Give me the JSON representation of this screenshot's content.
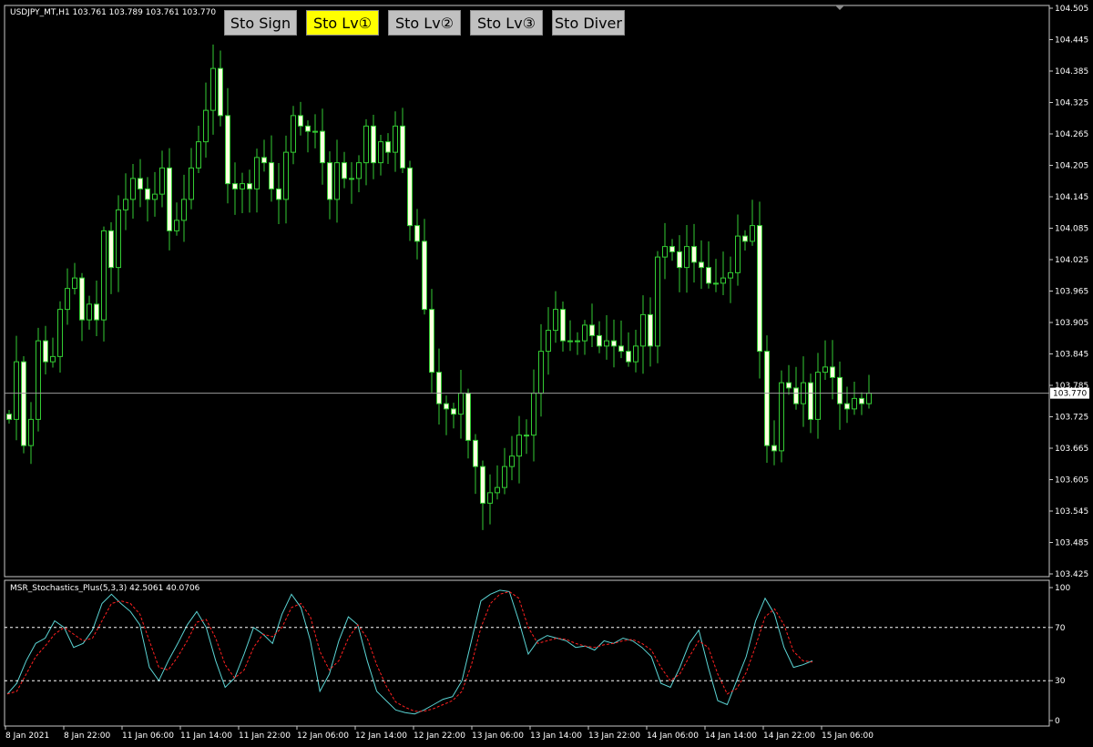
{
  "header": {
    "symbol_info": "USDJPY_MT,H1  103.761 103.789 103.761 103.770"
  },
  "indicator_header": {
    "text": "MSR_Stochastics_Plus(5,3,3) 42.5061 40.0706"
  },
  "buttons": [
    {
      "label": "Sto Sign",
      "color": "#c0c0c0"
    },
    {
      "label": "Sto Lv①",
      "color": "#ffff00"
    },
    {
      "label": "Sto Lv②",
      "color": "#c0c0c0"
    },
    {
      "label": "Sto Lv③",
      "color": "#c0c0c0"
    },
    {
      "label": "Sto Diver",
      "color": "#c0c0c0"
    }
  ],
  "colors": {
    "background": "#000000",
    "frame": "#c8c8c8",
    "candle": "#33cc33",
    "candle_bull_body": "#000000",
    "candle_bear_body": "#ffffe0",
    "stoch_main": "#5bd5d5",
    "stoch_signal": "#ff2020",
    "level_line": "#ffffff",
    "price_line": "#9a9a9a"
  },
  "chart_data": [
    {
      "type": "candlestick",
      "ylim": [
        103.425,
        104.505
      ],
      "y_ticks": [
        "104.505",
        "104.445",
        "104.385",
        "104.325",
        "104.265",
        "104.205",
        "104.145",
        "104.085",
        "104.025",
        "103.965",
        "103.905",
        "103.845",
        "103.785",
        "103.725",
        "103.665",
        "103.605",
        "103.545",
        "103.485",
        "103.425"
      ],
      "current_price": 103.77,
      "current_price_label": "103.770",
      "x_ticks": [
        "8 Jan 2021",
        "8 Jan 22:00",
        "11 Jan 06:00",
        "11 Jan 14:00",
        "11 Jan 22:00",
        "12 Jan 06:00",
        "12 Jan 14:00",
        "12 Jan 22:00",
        "13 Jan 06:00",
        "13 Jan 14:00",
        "13 Jan 22:00",
        "14 Jan 06:00",
        "14 Jan 14:00",
        "14 Jan 22:00",
        "15 Jan 06:00"
      ],
      "close": [
        103.72,
        103.83,
        103.67,
        103.72,
        103.87,
        103.83,
        103.84,
        103.93,
        103.97,
        103.99,
        103.91,
        103.94,
        103.91,
        104.08,
        104.01,
        104.12,
        104.14,
        104.18,
        104.16,
        104.14,
        104.15,
        104.2,
        104.08,
        104.1,
        104.14,
        104.2,
        104.25,
        104.31,
        104.39,
        104.3,
        104.17,
        104.16,
        104.17,
        104.16,
        104.22,
        104.21,
        104.16,
        104.14,
        104.23,
        104.3,
        104.28,
        104.27,
        104.27,
        104.21,
        104.14,
        104.21,
        104.18,
        104.18,
        104.21,
        104.28,
        104.21,
        104.25,
        104.23,
        104.28,
        104.2,
        104.09,
        104.06,
        103.93,
        103.81,
        103.75,
        103.74,
        103.73,
        103.77,
        103.68,
        103.63,
        103.56,
        103.58,
        103.59,
        103.63,
        103.65,
        103.69,
        103.69,
        103.77,
        103.85,
        103.89,
        103.93,
        103.87,
        103.87,
        103.87,
        103.9,
        103.88,
        103.86,
        103.87,
        103.86,
        103.85,
        103.83,
        103.86,
        103.92,
        103.86,
        104.03,
        104.05,
        104.04,
        104.01,
        104.05,
        104.02,
        104.01,
        103.98,
        103.98,
        103.99,
        104.0,
        104.07,
        104.06,
        104.09,
        103.85,
        103.67,
        103.66,
        103.79,
        103.78,
        103.75,
        103.79,
        103.72,
        103.81,
        103.82,
        103.8,
        103.75,
        103.74,
        103.76,
        103.75,
        103.77
      ]
    },
    {
      "type": "line",
      "name": "MSR_Stochastics_Plus(5,3,3)",
      "ylim": [
        0,
        100
      ],
      "y_ticks": [
        100,
        70,
        30,
        0
      ],
      "levels": [
        70,
        30
      ],
      "series": [
        {
          "role": "main",
          "values": [
            20,
            28,
            45,
            58,
            62,
            75,
            70,
            55,
            58,
            68,
            88,
            95,
            88,
            82,
            72,
            40,
            30,
            45,
            58,
            72,
            82,
            70,
            45,
            25,
            32,
            50,
            70,
            65,
            58,
            80,
            95,
            85,
            60,
            22,
            35,
            60,
            78,
            72,
            45,
            22,
            15,
            8,
            6,
            5,
            8,
            12,
            16,
            18,
            30,
            60,
            90,
            95,
            98,
            97,
            75,
            50,
            60,
            64,
            62,
            60,
            55,
            56,
            53,
            60,
            58,
            62,
            60,
            55,
            48,
            28,
            25,
            40,
            58,
            68,
            40,
            15,
            12,
            30,
            48,
            75,
            92,
            80,
            55,
            40,
            42,
            45
          ]
        },
        {
          "role": "signal",
          "values": [
            20,
            22,
            35,
            48,
            56,
            65,
            70,
            65,
            60,
            62,
            75,
            88,
            90,
            88,
            80,
            60,
            40,
            38,
            48,
            60,
            74,
            76,
            62,
            42,
            32,
            38,
            55,
            65,
            63,
            70,
            85,
            88,
            78,
            52,
            38,
            45,
            62,
            72,
            62,
            42,
            26,
            14,
            10,
            7,
            7,
            9,
            12,
            15,
            22,
            42,
            70,
            88,
            95,
            97,
            92,
            70,
            58,
            60,
            62,
            61,
            58,
            56,
            55,
            57,
            58,
            60,
            61,
            58,
            53,
            40,
            30,
            35,
            48,
            60,
            55,
            35,
            20,
            24,
            36,
            56,
            78,
            84,
            72,
            52,
            45,
            44
          ]
        }
      ]
    }
  ]
}
